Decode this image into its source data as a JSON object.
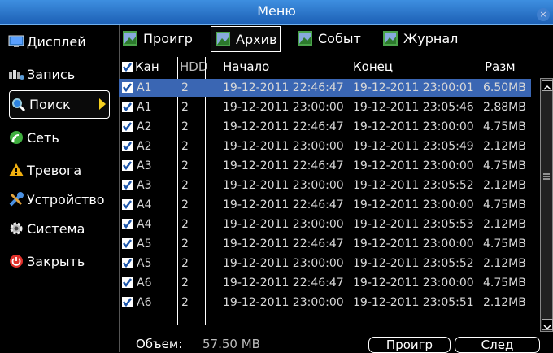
{
  "window": {
    "title": "Меню",
    "close_symbol": "×"
  },
  "sidebar": {
    "items": [
      {
        "label": "Дисплей",
        "icon": "monitor-icon"
      },
      {
        "label": "Запись",
        "icon": "record-icon"
      },
      {
        "label": "Поиск",
        "icon": "search-icon"
      },
      {
        "label": "Сеть",
        "icon": "network-icon"
      },
      {
        "label": "Тревога",
        "icon": "alarm-icon"
      },
      {
        "label": "Устройство",
        "icon": "tools-icon"
      },
      {
        "label": "Система",
        "icon": "gear-icon"
      },
      {
        "label": "Закрыть",
        "icon": "power-icon"
      }
    ],
    "active_index": 2
  },
  "tabs": [
    {
      "label": "Проигр"
    },
    {
      "label": "Архив"
    },
    {
      "label": "Событ"
    },
    {
      "label": "Журнал"
    }
  ],
  "active_tab": 1,
  "table": {
    "headers": {
      "channel": "Кан",
      "hdd": "HDD",
      "start": "Начало",
      "end": "Конец",
      "size": "Разм"
    },
    "rows": [
      {
        "ch": "A1",
        "hdd": "2",
        "start": "19-12-2011 22:46:47",
        "end": "19-12-2011 23:00:01",
        "size": "6.50MB"
      },
      {
        "ch": "A1",
        "hdd": "2",
        "start": "19-12-2011 23:00:00",
        "end": "19-12-2011 23:05:46",
        "size": "2.88MB"
      },
      {
        "ch": "A2",
        "hdd": "2",
        "start": "19-12-2011 22:46:47",
        "end": "19-12-2011 23:00:00",
        "size": "4.75MB"
      },
      {
        "ch": "A2",
        "hdd": "2",
        "start": "19-12-2011 23:00:00",
        "end": "19-12-2011 23:05:49",
        "size": "2.12MB"
      },
      {
        "ch": "A3",
        "hdd": "2",
        "start": "19-12-2011 22:46:47",
        "end": "19-12-2011 23:00:00",
        "size": "4.75MB"
      },
      {
        "ch": "A3",
        "hdd": "2",
        "start": "19-12-2011 23:00:00",
        "end": "19-12-2011 23:05:52",
        "size": "2.12MB"
      },
      {
        "ch": "A4",
        "hdd": "2",
        "start": "19-12-2011 22:46:47",
        "end": "19-12-2011 23:00:00",
        "size": "4.75MB"
      },
      {
        "ch": "A4",
        "hdd": "2",
        "start": "19-12-2011 23:00:00",
        "end": "19-12-2011 23:05:53",
        "size": "2.12MB"
      },
      {
        "ch": "A5",
        "hdd": "2",
        "start": "19-12-2011 22:46:47",
        "end": "19-12-2011 23:00:00",
        "size": "4.75MB"
      },
      {
        "ch": "A5",
        "hdd": "2",
        "start": "19-12-2011 23:00:00",
        "end": "19-12-2011 23:05:52",
        "size": "2.12MB"
      },
      {
        "ch": "A6",
        "hdd": "2",
        "start": "19-12-2011 22:46:47",
        "end": "19-12-2011 23:00:00",
        "size": "4.75MB"
      },
      {
        "ch": "A6",
        "hdd": "2",
        "start": "19-12-2011 23:00:00",
        "end": "19-12-2011 23:05:51",
        "size": "2.12MB"
      }
    ],
    "selected_index": 0
  },
  "footer": {
    "volume_label": "Объем:",
    "volume_value": "57.50 MB",
    "play_button": "Проигр",
    "next_button": "След"
  },
  "colors": {
    "titlebar": "#2a77d0",
    "selection": "#3a66b3",
    "accent_arrow": "#f5d020"
  }
}
